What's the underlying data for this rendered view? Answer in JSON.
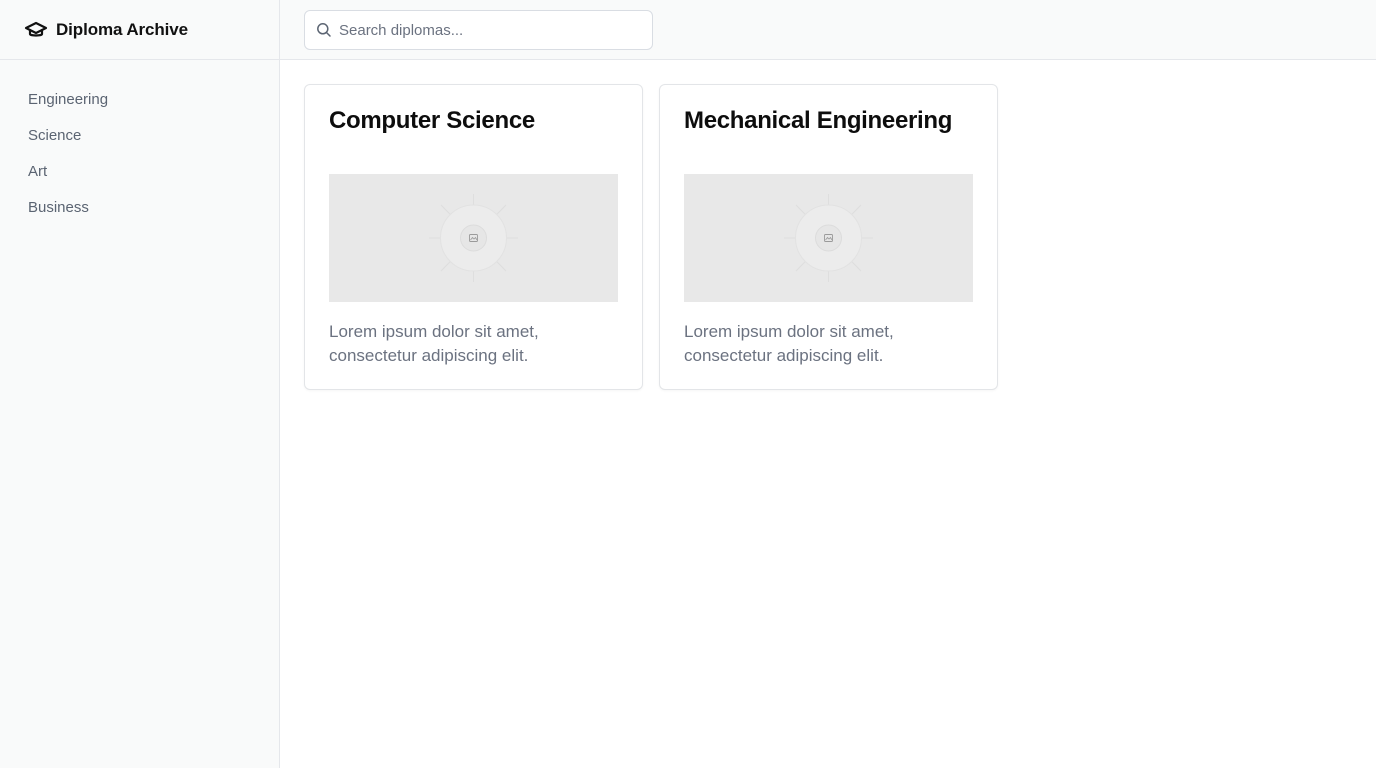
{
  "app": {
    "title": "Diploma Archive",
    "icon": "graduation-cap-icon"
  },
  "sidebar": {
    "items": [
      {
        "label": "Engineering"
      },
      {
        "label": "Science"
      },
      {
        "label": "Art"
      },
      {
        "label": "Business"
      }
    ]
  },
  "search": {
    "placeholder": "Search diplomas...",
    "value": "",
    "icon": "search-icon"
  },
  "cards": [
    {
      "title": "Computer Science",
      "description": "Lorem ipsum dolor sit amet, consectetur adipiscing elit.",
      "image_icon": "image-placeholder-icon"
    },
    {
      "title": "Mechanical Engineering",
      "description": "Lorem ipsum dolor sit amet, consectetur adipiscing elit.",
      "image_icon": "image-placeholder-icon"
    }
  ],
  "colors": {
    "sidebar_bg": "#f9fafa",
    "border": "#e5e7eb",
    "muted_text": "#6b7280",
    "placeholder_bg": "#e8e8e8"
  }
}
